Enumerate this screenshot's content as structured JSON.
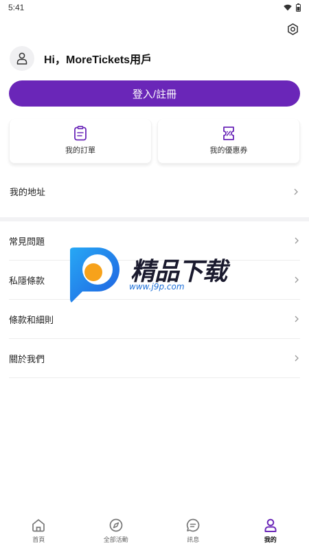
{
  "status_bar": {
    "time": "5:41"
  },
  "profile": {
    "greeting": "Hi，MoreTickets用戶"
  },
  "login_button": "登入/註冊",
  "quick_cards": [
    {
      "label": "我的訂單",
      "icon": "clipboard-icon"
    },
    {
      "label": "我的優惠券",
      "icon": "coupon-icon"
    }
  ],
  "address_item": "我的地址",
  "menu_items": [
    {
      "label": "常見問題"
    },
    {
      "label": "私隱條款"
    },
    {
      "label": "條款和細則"
    },
    {
      "label": "關於我們"
    }
  ],
  "watermark": {
    "title": "精品下载",
    "url": "www.j9p.com"
  },
  "tabs": [
    {
      "label": "首頁",
      "icon": "home-icon"
    },
    {
      "label": "全部活動",
      "icon": "compass-icon"
    },
    {
      "label": "訊息",
      "icon": "message-icon"
    },
    {
      "label": "我的",
      "icon": "user-icon",
      "active": true
    }
  ],
  "colors": {
    "accent": "#6a26b8",
    "divider": "#f2f2f4"
  }
}
